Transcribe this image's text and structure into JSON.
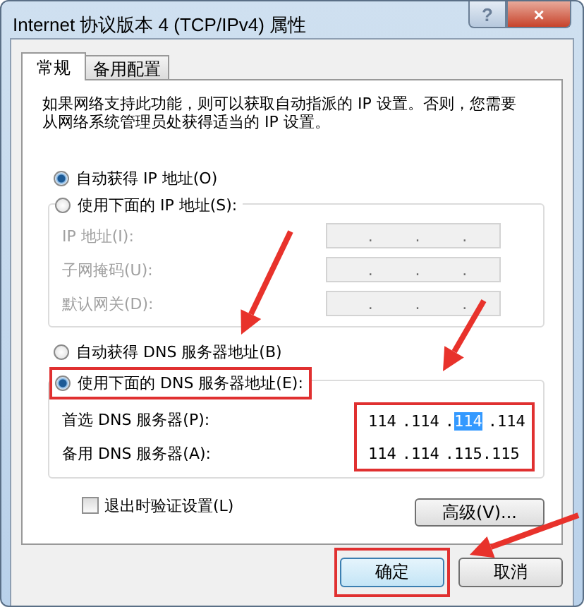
{
  "window": {
    "title": "Internet 协议版本 4 (TCP/IPv4) 属性",
    "help": "?",
    "close": "×"
  },
  "tabs": [
    {
      "label": "常规",
      "selected": true
    },
    {
      "label": "备用配置",
      "selected": false
    }
  ],
  "description": "如果网络支持此功能，则可以获取自动指派的 IP 设置。否则，您需要从网络系统管理员处获得适当的 IP 设置。",
  "ip_mode": [
    {
      "label": "自动获得 IP 地址(O)",
      "selected": true
    },
    {
      "label": "使用下面的 IP 地址(S):",
      "selected": false
    }
  ],
  "ip_fields": [
    {
      "label": "IP 地址(I):",
      "disabled": true,
      "dots": [
        ".",
        ".",
        "."
      ]
    },
    {
      "label": "子网掩码(U):",
      "disabled": true,
      "dots": [
        ".",
        ".",
        "."
      ]
    },
    {
      "label": "默认网关(D):",
      "disabled": true,
      "dots": [
        ".",
        ".",
        "."
      ]
    }
  ],
  "dns_mode": [
    {
      "label": "自动获得 DNS 服务器地址(B)",
      "selected": false
    },
    {
      "label": "使用下面的 DNS 服务器地址(E):",
      "selected": true
    }
  ],
  "dns_fields": [
    {
      "label": "首选 DNS 服务器(P):",
      "disabled": false,
      "segments": [
        {
          "text": "114",
          "selected": false
        },
        {
          "text": ".114",
          "selected": false
        },
        {
          "text": ".",
          "selected": false
        },
        {
          "text": "114",
          "selected": true
        },
        {
          "text": ".114",
          "selected": false
        }
      ]
    },
    {
      "label": "备用 DNS 服务器(A):",
      "disabled": false,
      "segments": [
        {
          "text": "114",
          "selected": false
        },
        {
          "text": ".114",
          "selected": false
        },
        {
          "text": ".115",
          "selected": false
        },
        {
          "text": ".115",
          "selected": false
        }
      ]
    }
  ],
  "validate": {
    "label": "退出时验证设置(L)",
    "checked": false
  },
  "advanced_button": "高级(V)...",
  "buttons": [
    "确定",
    "取消"
  ]
}
